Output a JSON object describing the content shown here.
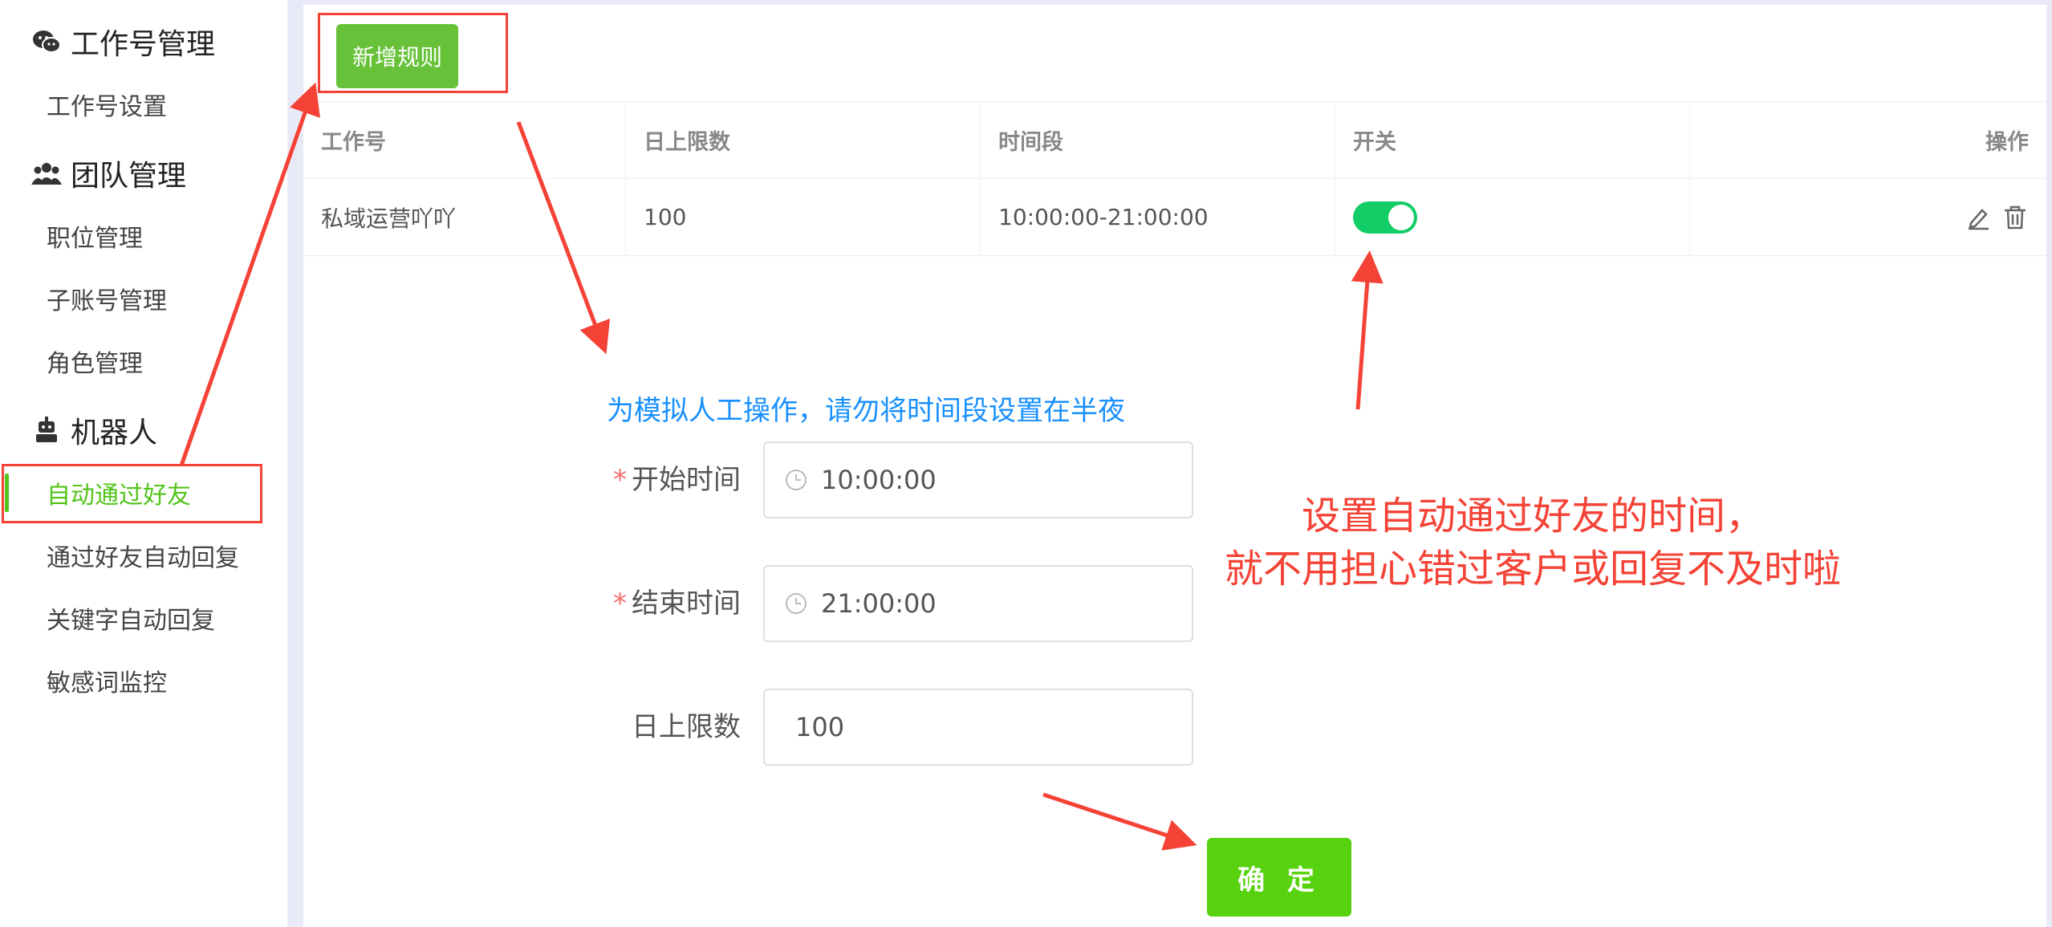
{
  "sidebar": {
    "groups": [
      {
        "title": "工作号管理",
        "icon": "wechat-icon",
        "items": [
          "工作号设置"
        ]
      },
      {
        "title": "团队管理",
        "icon": "team-icon",
        "items": [
          "职位管理",
          "子账号管理",
          "角色管理"
        ]
      },
      {
        "title": "机器人",
        "icon": "robot-icon",
        "items": [
          "自动通过好友",
          "通过好友自动回复",
          "关键字自动回复",
          "敏感词监控"
        ]
      }
    ],
    "active_item": "自动通过好友"
  },
  "toolbar": {
    "add_rule_label": "新增规则"
  },
  "table": {
    "headers": [
      "工作号",
      "日上限数",
      "时间段",
      "开关",
      "操作"
    ],
    "rows": [
      {
        "account": "私域运营吖吖",
        "daily_limit": "100",
        "time_range": "10:00:00-21:00:00",
        "enabled": true
      }
    ]
  },
  "form": {
    "hint": "为模拟人工操作，请勿将时间段设置在半夜",
    "start_label": "开始时间",
    "start_value": "10:00:00",
    "end_label": "结束时间",
    "end_value": "21:00:00",
    "limit_label": "日上限数",
    "limit_value": "100",
    "required_mark": "*",
    "submit_label": "确 定"
  },
  "annotation": {
    "line1": "设置自动通过好友的时间，",
    "line2": "就不用担心错过客户或回复不及时啦"
  },
  "colors": {
    "accent_green": "#52c41a",
    "button_green": "#67c23a",
    "switch_on": "#13ce66",
    "hint_blue": "#1890ff",
    "annotation_red": "#f44336"
  }
}
